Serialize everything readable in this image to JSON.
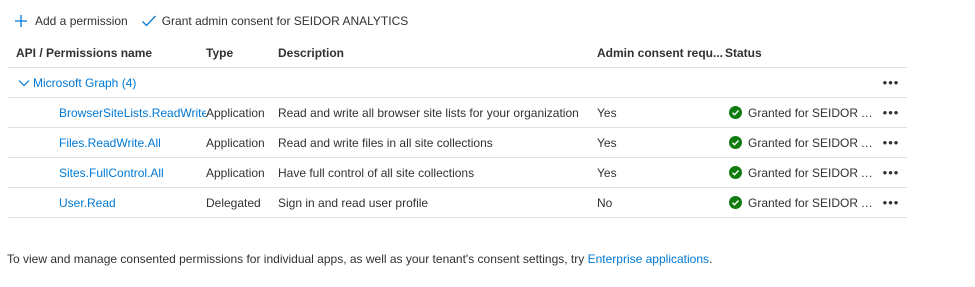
{
  "toolbar": {
    "add_label": "Add a permission",
    "grant_label": "Grant admin consent for SEIDOR ANALYTICS"
  },
  "columns": {
    "name": "API / Permissions name",
    "type": "Type",
    "description": "Description",
    "admin": "Admin consent requ...",
    "status": "Status"
  },
  "group": {
    "label": "Microsoft Graph (4)"
  },
  "rows": [
    {
      "name": "BrowserSiteLists.ReadWrite.A",
      "type": "Application",
      "description": "Read and write all browser site lists for your organization",
      "admin": "Yes",
      "status": "Granted for SEIDOR AN..."
    },
    {
      "name": "Files.ReadWrite.All",
      "type": "Application",
      "description": "Read and write files in all site collections",
      "admin": "Yes",
      "status": "Granted for SEIDOR AN..."
    },
    {
      "name": "Sites.FullControl.All",
      "type": "Application",
      "description": "Have full control of all site collections",
      "admin": "Yes",
      "status": "Granted for SEIDOR AN..."
    },
    {
      "name": "User.Read",
      "type": "Delegated",
      "description": "Sign in and read user profile",
      "admin": "No",
      "status": "Granted for SEIDOR AN..."
    }
  ],
  "more_glyph": "•••",
  "footer": {
    "text": "To view and manage consented permissions for individual apps, as well as your tenant's consent settings, try ",
    "link": "Enterprise applications",
    "end": "."
  },
  "colors": {
    "accent": "#0078d4",
    "success": "#107c10",
    "text": "#323130",
    "divider": "#e1dfdd"
  }
}
